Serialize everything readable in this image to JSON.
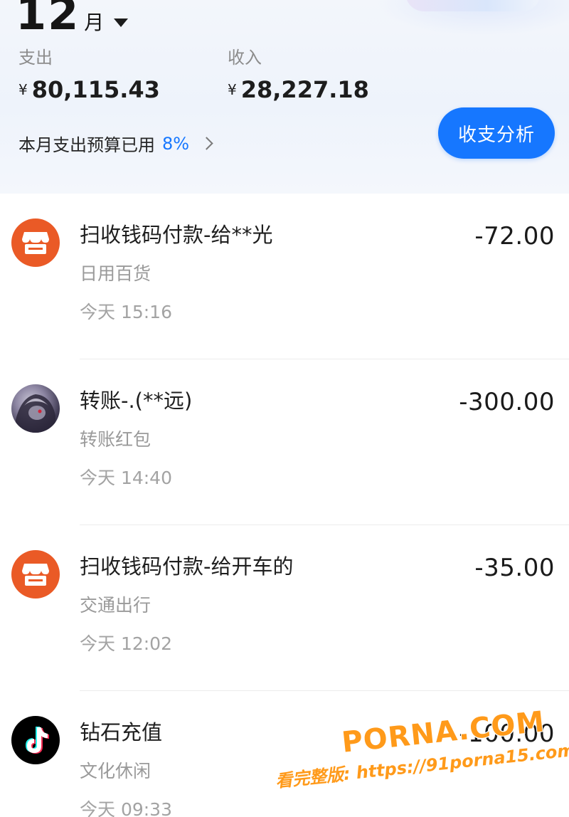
{
  "header": {
    "month_number": "12",
    "month_unit": "月",
    "expense": {
      "label": "支出",
      "currency": "¥",
      "amount": "80,115.43"
    },
    "income": {
      "label": "收入",
      "currency": "¥",
      "amount": "28,227.18"
    },
    "budget": {
      "text": "本月支出预算已用",
      "percent": "8%"
    },
    "analysis_button": "收支分析"
  },
  "transactions": [
    {
      "icon": "shop-icon",
      "title": "扫收钱码付款-给**光",
      "category": "日用百货",
      "time": "今天 15:16",
      "amount": "-72.00"
    },
    {
      "icon": "user-avatar",
      "title": "转账-.(**远)",
      "category": "转账红包",
      "time": "今天 14:40",
      "amount": "-300.00"
    },
    {
      "icon": "shop-icon",
      "title": "扫收钱码付款-给开车的",
      "category": "交通出行",
      "time": "今天 12:02",
      "amount": "-35.00"
    },
    {
      "icon": "tiktok-icon",
      "title": "钻石充值",
      "category": "文化休闲",
      "time": "今天 09:33",
      "amount": "-100.00"
    }
  ],
  "watermark": {
    "line1": "PORNA.COM",
    "line2": "看完整版: https://91porna15.com"
  },
  "colors": {
    "accent": "#1677ff",
    "shop_icon_bg": "#ea5a26",
    "watermark": "#ff9a1a"
  }
}
